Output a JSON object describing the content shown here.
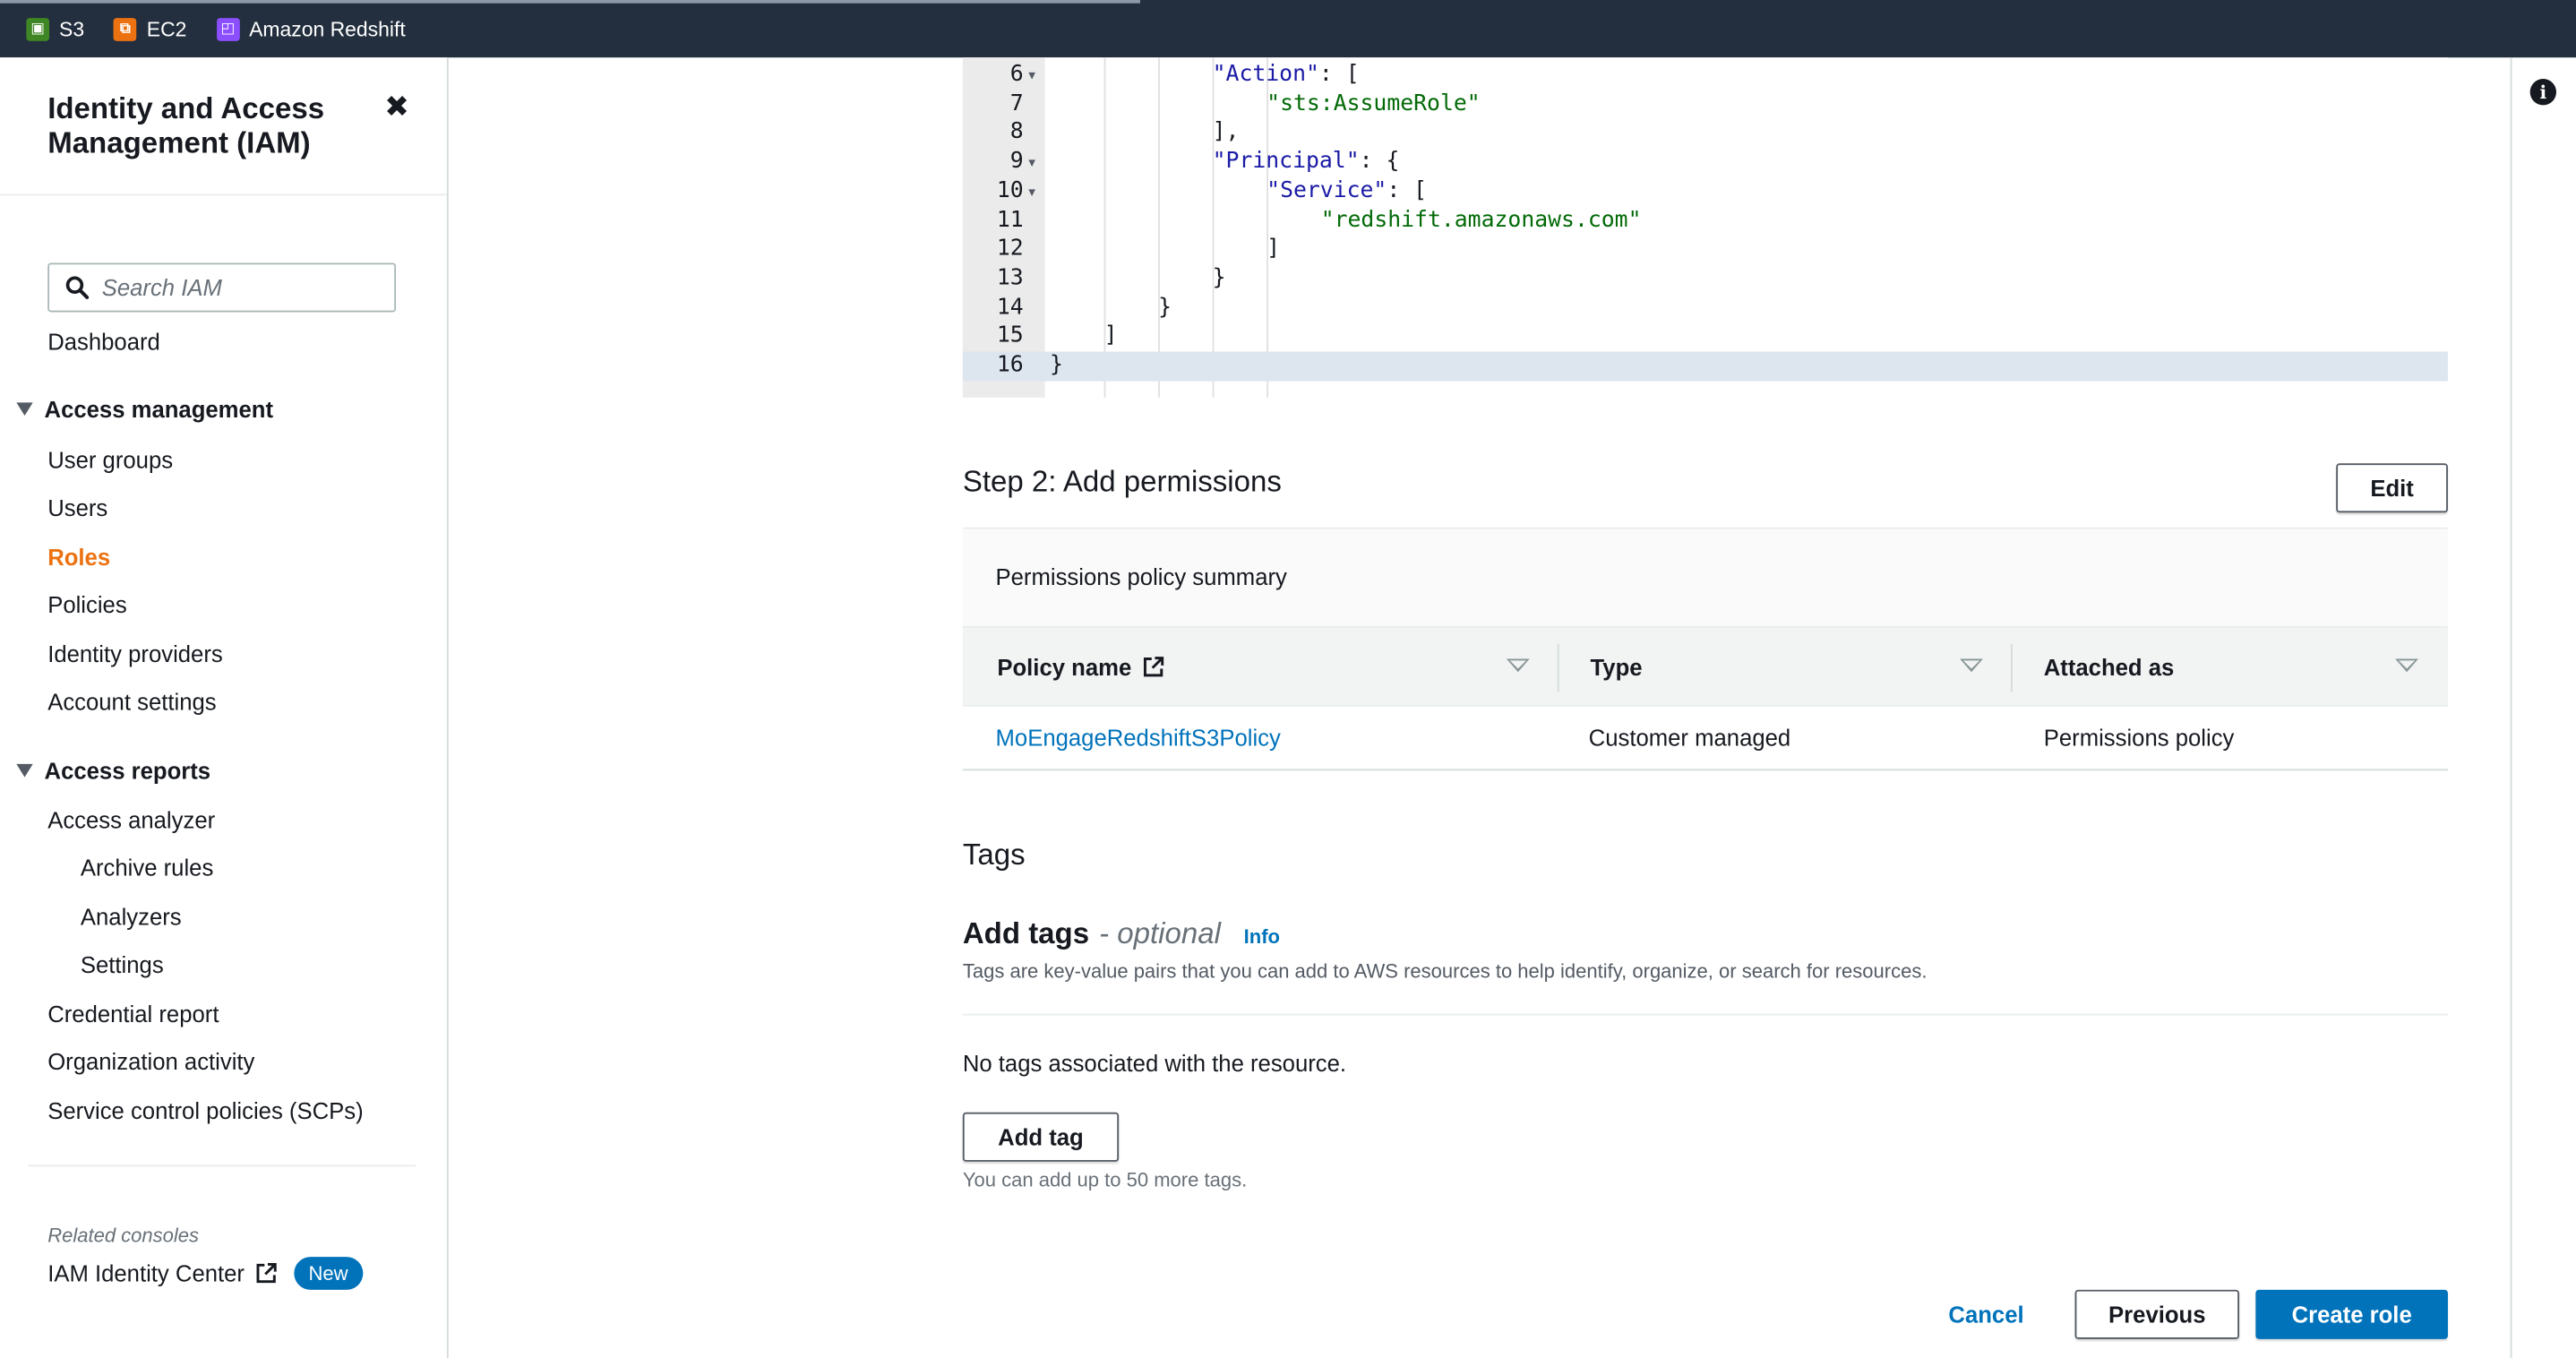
{
  "topnav": {
    "favorites": [
      {
        "label": "S3",
        "icon": "s3-icon",
        "color": "#3f8624"
      },
      {
        "label": "EC2",
        "icon": "ec2-icon",
        "color": "#ec7211"
      },
      {
        "label": "Amazon Redshift",
        "icon": "redshift-icon",
        "color": "#8c4fff"
      }
    ]
  },
  "sidebar": {
    "title": "Identity and Access Management (IAM)",
    "search_placeholder": "Search IAM",
    "dashboard": "Dashboard",
    "access_management": {
      "label": "Access management",
      "items": [
        "User groups",
        "Users",
        "Roles",
        "Policies",
        "Identity providers",
        "Account settings"
      ],
      "active": "Roles"
    },
    "access_reports": {
      "label": "Access reports",
      "analyzer": "Access analyzer",
      "analyzer_sub": [
        "Archive rules",
        "Analyzers",
        "Settings"
      ],
      "items": [
        "Credential report",
        "Organization activity",
        "Service control policies (SCPs)"
      ]
    },
    "related_consoles": "Related consoles",
    "identity_center": "IAM Identity Center",
    "new_badge": "New"
  },
  "editor": {
    "lines": [
      {
        "n": "6",
        "fold": true,
        "indent": 3,
        "parts": [
          {
            "t": "\"Action\"",
            "c": "str"
          },
          {
            "t": ": [",
            "c": ""
          }
        ]
      },
      {
        "n": "7",
        "fold": false,
        "indent": 4,
        "parts": [
          {
            "t": "\"sts:AssumeRole\"",
            "c": "strg"
          }
        ]
      },
      {
        "n": "8",
        "fold": false,
        "indent": 3,
        "parts": [
          {
            "t": "],",
            "c": ""
          }
        ]
      },
      {
        "n": "9",
        "fold": true,
        "indent": 3,
        "parts": [
          {
            "t": "\"Principal\"",
            "c": "str"
          },
          {
            "t": ": {",
            "c": ""
          }
        ]
      },
      {
        "n": "10",
        "fold": true,
        "indent": 4,
        "parts": [
          {
            "t": "\"Service\"",
            "c": "str"
          },
          {
            "t": ": [",
            "c": ""
          }
        ]
      },
      {
        "n": "11",
        "fold": false,
        "indent": 5,
        "parts": [
          {
            "t": "\"redshift.amazonaws.com\"",
            "c": "strg"
          }
        ]
      },
      {
        "n": "12",
        "fold": false,
        "indent": 4,
        "parts": [
          {
            "t": "]",
            "c": ""
          }
        ]
      },
      {
        "n": "13",
        "fold": false,
        "indent": 3,
        "parts": [
          {
            "t": "}",
            "c": ""
          }
        ]
      },
      {
        "n": "14",
        "fold": false,
        "indent": 2,
        "parts": [
          {
            "t": "}",
            "c": ""
          }
        ]
      },
      {
        "n": "15",
        "fold": false,
        "indent": 1,
        "parts": [
          {
            "t": "]",
            "c": ""
          }
        ]
      },
      {
        "n": "16",
        "fold": false,
        "indent": 0,
        "parts": [
          {
            "t": "}",
            "c": ""
          }
        ],
        "current": true
      }
    ]
  },
  "step2": {
    "title": "Step 2: Add permissions",
    "edit": "Edit",
    "summary": "Permissions policy summary",
    "columns": [
      "Policy name",
      "Type",
      "Attached as"
    ],
    "rows": [
      {
        "policy": "MoEngageRedshiftS3Policy",
        "type": "Customer managed",
        "attached": "Permissions policy"
      }
    ]
  },
  "tags": {
    "title": "Tags",
    "add_title": "Add tags",
    "optional": "- optional",
    "info": "Info",
    "description": "Tags are key-value pairs that you can add to AWS resources to help identify, organize, or search for resources.",
    "empty": "No tags associated with the resource.",
    "add_button": "Add tag",
    "hint": "You can add up to 50 more tags."
  },
  "footer": {
    "cancel": "Cancel",
    "previous": "Previous",
    "create": "Create role"
  }
}
